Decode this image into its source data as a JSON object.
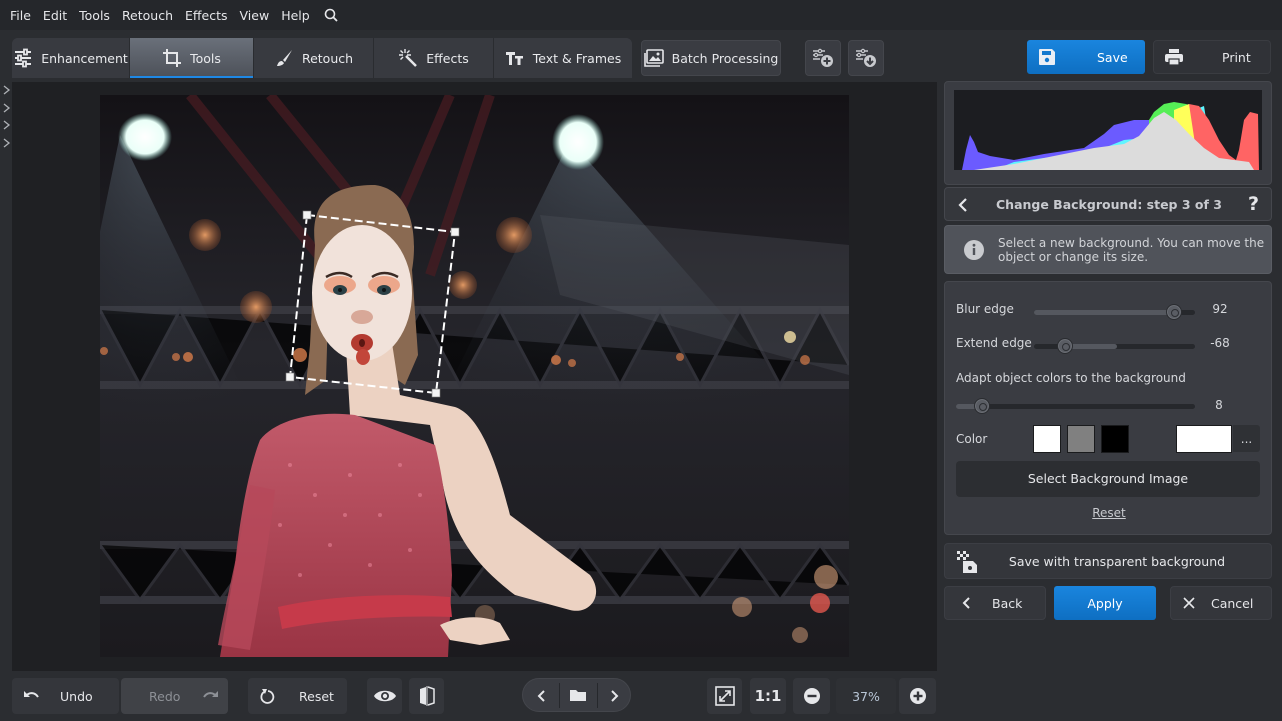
{
  "menu": {
    "items": [
      "File",
      "Edit",
      "Tools",
      "Retouch",
      "Effects",
      "View",
      "Help"
    ],
    "search_icon": "search-icon"
  },
  "tabs": [
    {
      "label": "Enhancement",
      "icon": "sliders-icon",
      "active": false
    },
    {
      "label": "Tools",
      "icon": "crop-icon",
      "active": true
    },
    {
      "label": "Retouch",
      "icon": "brush-icon",
      "active": false
    },
    {
      "label": "Effects",
      "icon": "magic-wand-icon",
      "active": false
    },
    {
      "label": "Text & Frames",
      "icon": "text-icon",
      "active": false
    }
  ],
  "toolbar": {
    "batch_label": "Batch Processing",
    "add_preset_icon": "add-preset-icon",
    "download_preset_icon": "download-preset-icon",
    "save_label": "Save",
    "print_label": "Print"
  },
  "histogram": {
    "channels": [
      "blue",
      "cyan",
      "green",
      "yellow",
      "red",
      "luminance"
    ]
  },
  "wizard": {
    "title": "Change Background: step 3 of 3",
    "back_icon": "chevron-left-icon",
    "help_label": "?",
    "info_text_line1": "Select a new background. You can move the",
    "info_text_line2": "object or change its size."
  },
  "controls": {
    "blur_edge": {
      "label": "Blur edge",
      "value": "92",
      "min": 0,
      "max": 100,
      "current": 92
    },
    "extend_edge": {
      "label": "Extend edge",
      "value": "-68",
      "min": -100,
      "max": 100,
      "current": -68
    },
    "adapt_colors": {
      "label": "Adapt object colors to the background",
      "value": "8",
      "min": 0,
      "max": 100,
      "current": 8
    },
    "color_label": "Color",
    "swatches": [
      "#ffffff",
      "#808080",
      "#000000"
    ],
    "custom_color": "#ffffff",
    "more_label": "...",
    "select_bg_label": "Select Background Image",
    "reset_label": "Reset"
  },
  "actions": {
    "save_transparent_label": "Save with transparent background",
    "back_label": "Back",
    "apply_label": "Apply",
    "cancel_label": "Cancel"
  },
  "bottom": {
    "undo_label": "Undo",
    "redo_label": "Redo",
    "reset_label": "Reset",
    "fit_label": "fit-screen",
    "one_to_one_label": "1:1",
    "zoom_value": "37%"
  },
  "colors": {
    "accent": "#1a85de",
    "background": "#2b2d31",
    "panel": "#3a3c42"
  }
}
